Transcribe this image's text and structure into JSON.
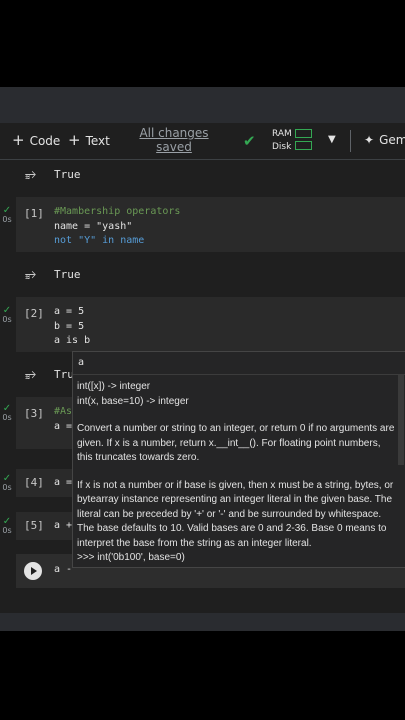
{
  "toolbar": {
    "code_label": "Code",
    "text_label": "Text",
    "saved_line1": "All changes",
    "saved_line2": "saved",
    "ram_label": "RAM",
    "disk_label": "Disk",
    "gemini_label": "Gem"
  },
  "outputs": {
    "out0": "True",
    "out1": "True",
    "out2": "Tru"
  },
  "cells": [
    {
      "exec": "[1]",
      "time": "0s",
      "lines": [
        "#Mambership operators",
        "name = \"yash\"",
        "not \"Y\" in name"
      ]
    },
    {
      "exec": "[2]",
      "time": "0s",
      "lines": [
        "a = 5",
        "b = 5",
        "a is b"
      ]
    },
    {
      "exec": "[3]",
      "time": "0s",
      "lines": [
        "#As",
        "a ="
      ]
    },
    {
      "exec": "[4]",
      "time": "0s",
      "lines": [
        "a ="
      ]
    },
    {
      "exec": "[5]",
      "time": "0s",
      "lines": [
        "a +"
      ]
    }
  ],
  "active_cell": {
    "code": "a -"
  },
  "tooltip": {
    "title": "a",
    "sig1": "int([x]) -> integer",
    "sig2": "int(x, base=10) -> integer",
    "para1": "Convert a number or string to an integer, or return 0 if no arguments are given.  If x is a number, return x.__int__().  For floating point numbers, this truncates towards zero.",
    "para2": "If x is not a number or if base is given, then x must be a string, bytes, or bytearray instance representing an integer literal in the given base.  The literal can be preceded by '+' or '-' and be surrounded by whitespace.  The base defaults to 10.  Valid bases are 0 and 2-36. Base 0 means to interpret the base from the string as an integer literal.",
    "example": ">>> int('0b100', base=0)"
  },
  "colors": {
    "accent_green": "#34a853",
    "bg": "#1f1f1f",
    "cell_bg": "#2a2a2a"
  }
}
